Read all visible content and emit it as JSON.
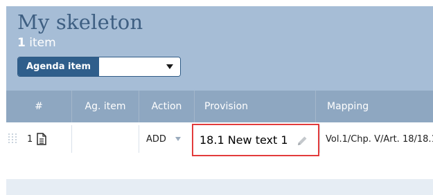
{
  "header": {
    "title": "My skeleton",
    "count": "1",
    "count_label": "item"
  },
  "filter": {
    "label": "Agenda item",
    "value": ""
  },
  "columns": [
    "#",
    "Ag. item",
    "Action",
    "Provision",
    "Mapping"
  ],
  "rows": [
    {
      "number": "1",
      "ag_item": "",
      "action": "ADD",
      "provision": "18.1 New text 1",
      "mapping": "Vol.1/Chp. V/Art. 18/18.1"
    }
  ],
  "icons": {
    "drag": "drag-handle-icon",
    "document": "document-icon",
    "edit": "pencil-icon",
    "dropdown": "chevron-down-icon"
  },
  "colors": {
    "header_bg": "#a6bdd6",
    "column_header_bg": "#8ea7c1",
    "filter_label_bg": "#2f5e8b",
    "highlight_border": "#e23b3b",
    "title_color": "#3e5f82"
  }
}
